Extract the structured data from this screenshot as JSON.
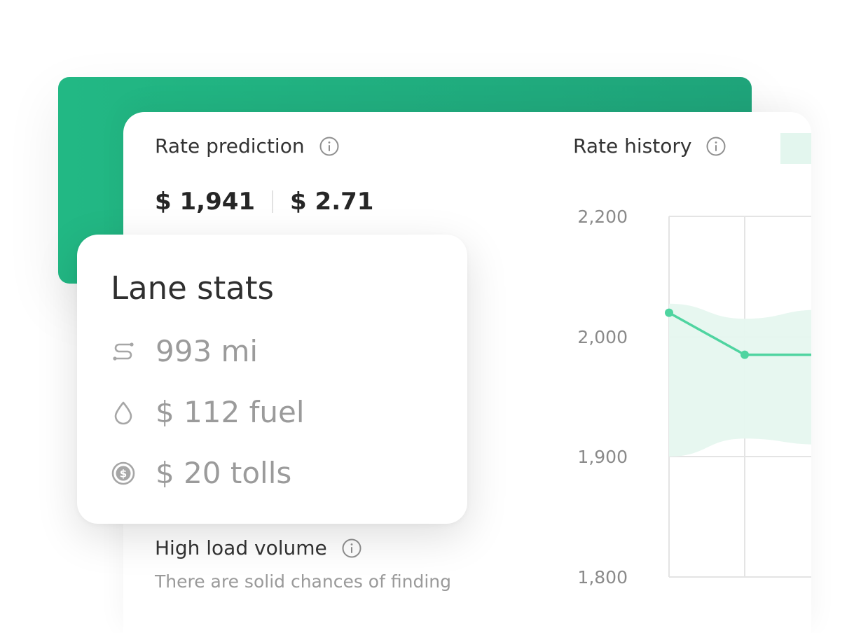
{
  "rate_prediction": {
    "title": "Rate prediction",
    "total_price": "$ 1,941",
    "per_mile_price": "$ 2.71"
  },
  "rate_history": {
    "title": "Rate history"
  },
  "load_volume": {
    "title": "High load volume",
    "description": "There are solid chances of finding"
  },
  "lane_stats": {
    "title": "Lane stats",
    "distance": "993 mi",
    "fuel": "$ 112 fuel",
    "tolls": "$ 20 tolls"
  },
  "icons": {
    "info": "info-icon",
    "distance": "route-icon",
    "fuel": "fuel-drop-icon",
    "tolls": "dollar-coin-icon"
  },
  "colors": {
    "brand_green": "#22b884",
    "line_green": "#4fd4a0",
    "band_green": "#e6f7ef"
  },
  "chart_data": {
    "type": "line",
    "title": "",
    "xlabel": "",
    "ylabel": "",
    "y_ticks": [
      "2,200",
      "2,000",
      "1,900",
      "1,800"
    ],
    "ylim": [
      1800,
      2200
    ],
    "grid": true,
    "series": [
      {
        "values": [
          2040,
          1985,
          1985
        ],
        "band_upper": [
          2055,
          2030,
          2045
        ],
        "band_lower": [
          1900,
          1915,
          1910
        ]
      }
    ]
  }
}
